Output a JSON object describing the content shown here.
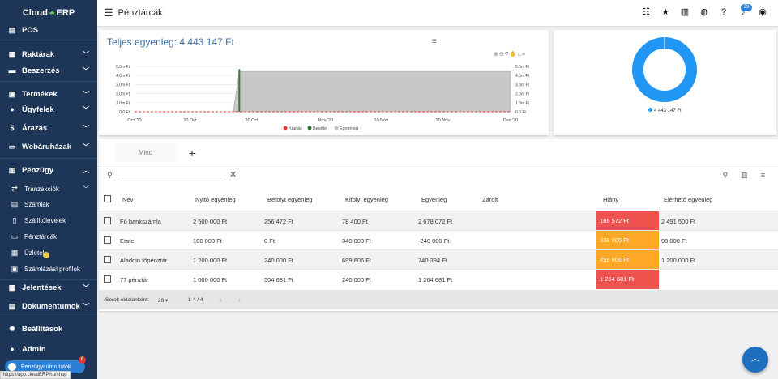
{
  "app": {
    "logo_left": "Cloud",
    "logo_right": "ERP",
    "page_title": "Pénztárcák",
    "status_url": "https://app.cloudERP.hu/shop",
    "notif_count": "99",
    "guide_label": "Pénzügyi útmutatók",
    "guide_badge": "6"
  },
  "sidebar": {
    "items": [
      {
        "label": "POS",
        "icon": "cash-register-icon"
      },
      {
        "label": "Raktárak",
        "icon": "warehouse-icon"
      },
      {
        "label": "Beszerzés",
        "icon": "truck-icon"
      },
      {
        "label": "Termékek",
        "icon": "box-icon"
      },
      {
        "label": "Ügyfelek",
        "icon": "users-icon"
      },
      {
        "label": "Árazás",
        "icon": "dollar-icon"
      },
      {
        "label": "Webáruházak",
        "icon": "store-icon"
      },
      {
        "label": "Pénzügy",
        "icon": "bank-icon"
      },
      {
        "label": "Tranzakciók",
        "icon": "transfer-icon"
      },
      {
        "label": "Számlák",
        "icon": "invoice-icon"
      },
      {
        "label": "Szállítólevelek",
        "icon": "document-icon"
      },
      {
        "label": "Pénztárcák",
        "icon": "wallet-icon"
      },
      {
        "label": "Üzletek",
        "icon": "shop-icon"
      },
      {
        "label": "Számlázási profilok",
        "icon": "id-card-icon"
      },
      {
        "label": "Jelentések",
        "icon": "chart-icon"
      },
      {
        "label": "Dokumentumok",
        "icon": "folder-icon"
      },
      {
        "label": "Beállítások",
        "icon": "gear-icon"
      },
      {
        "label": "Admin",
        "icon": "admin-icon"
      }
    ]
  },
  "chart": {
    "title": "Teljes egyenleg: 4 443 147 Ft",
    "chart_data": {
      "type": "area",
      "x_ticks": [
        "Oct '20",
        "10 Oct",
        "20 Oct",
        "Nov '20",
        "10 Nov",
        "20 Nov",
        "Dec '20"
      ],
      "y_ticks": [
        "0.0 Ft",
        "1.0m Ft",
        "2.0m Ft",
        "3.0m Ft",
        "4.0m Ft",
        "5.0m Ft"
      ],
      "ylim": [
        0,
        5000000
      ],
      "legend": [
        "Kiadás",
        "Bevétel",
        "Egyenleg"
      ],
      "legend_colors": [
        "#e53935",
        "#2e7d32",
        "#bdbdbd"
      ],
      "series": [
        {
          "name": "Egyenleg",
          "color": "#c8c8c8",
          "x": [
            "2020-10-17",
            "2020-10-18",
            "2020-12-01"
          ],
          "values": [
            0,
            4443147,
            4443147
          ]
        },
        {
          "name": "Bevétel",
          "color": "#2e7d32",
          "x": [
            "2020-10-18"
          ],
          "values": [
            4700000
          ]
        },
        {
          "name": "Kiadás",
          "color": "#e53935",
          "x": [
            "2020-10-01",
            "2020-12-01"
          ],
          "values": [
            0,
            0
          ]
        }
      ]
    }
  },
  "donut": {
    "legend": "4 443 147 Ft",
    "color": "#2196f3",
    "chart_data": {
      "type": "pie",
      "values": [
        4443147
      ],
      "labels": [
        "4 443 147 Ft"
      ]
    }
  },
  "table": {
    "tab_label": "Mind",
    "tab_add": "+",
    "search_placeholder": "",
    "headers": [
      "Név",
      "Nyitó egyenleg",
      "Befolyt egyenleg",
      "Kifolyt egyenleg",
      "Egyenleg",
      "Zárolt",
      "Hiány",
      "Elérhető egyenleg"
    ],
    "rows": [
      {
        "name": "Fő bankszámla",
        "opening": "2 500 000 Ft",
        "in": "256 472 Ft",
        "out": "78 400 Ft",
        "balance": "2 678 072 Ft",
        "locked": "",
        "deficit": "186 572 Ft",
        "deficit_color": "#ef5350",
        "available": "2 491 500 Ft"
      },
      {
        "name": "Erste",
        "opening": "100 000 Ft",
        "in": "0 Ft",
        "out": "340 000 Ft",
        "balance": "-240 000 Ft",
        "locked": "",
        "deficit": "338 000 Ft",
        "deficit_color": "#ffa726",
        "available": "98 000 Ft"
      },
      {
        "name": "Aladdin főpénztár",
        "opening": "1 200 000 Ft",
        "in": "240 000 Ft",
        "out": "699 606 Ft",
        "balance": "740 394 Ft",
        "locked": "",
        "deficit": "459 606 Ft",
        "deficit_color": "#ffa726",
        "available": "1 200 000 Ft"
      },
      {
        "name": "77 pénztár",
        "opening": "1 000 000 Ft",
        "in": "504 681 Ft",
        "out": "240 000 Ft",
        "balance": "1 264 681 Ft",
        "locked": "",
        "deficit": "1 264 681 Ft",
        "deficit_color": "#ef5350",
        "available": ""
      }
    ],
    "footer": {
      "rows_per_page_label": "Sorok oldalanként:",
      "rows_per_page": "20",
      "range": "1-4 / 4"
    }
  }
}
